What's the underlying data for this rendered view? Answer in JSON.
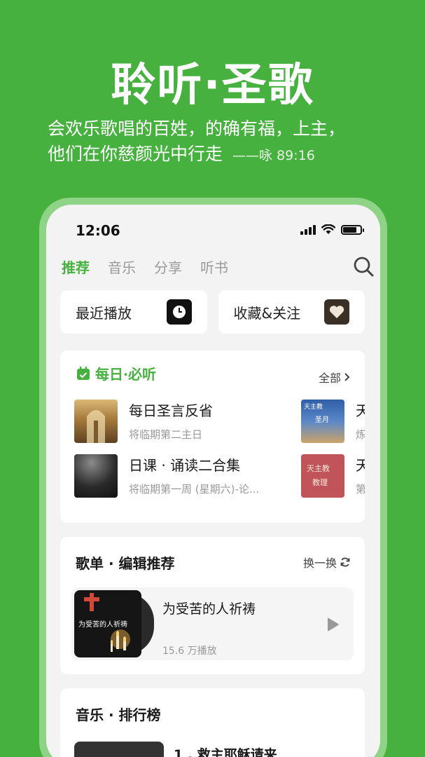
{
  "promo": {
    "title": "聆听·圣歌",
    "verse_line1": "会欢乐歌唱的百姓，的确有福，上主，",
    "verse_line2": "他们在你慈颜光中行走",
    "verse_ref": "——咏 89:16"
  },
  "status_bar": {
    "time": "12:06"
  },
  "tabs": [
    {
      "label": "推荐",
      "active": true
    },
    {
      "label": "音乐",
      "active": false
    },
    {
      "label": "分享",
      "active": false
    },
    {
      "label": "听书",
      "active": false
    }
  ],
  "quick_links": [
    {
      "label": "最近播放",
      "icon": "clock-icon"
    },
    {
      "label": "收藏&关注",
      "icon": "heart-icon"
    }
  ],
  "daily": {
    "title": "每日·必听",
    "see_all": "全部",
    "items": [
      {
        "title": "每日圣言反省",
        "subtitle": "将临期第二主日"
      },
      {
        "title": "日课 · 诵读二合集",
        "subtitle": "将临期第一周 (星期六)-论..."
      },
      {
        "title": "天",
        "subtitle": "炼"
      },
      {
        "title": "天",
        "subtitle": "第"
      }
    ],
    "thumb_texts": [
      "天主教",
      "圣月",
      "天主教",
      "教理"
    ]
  },
  "editor_picks": {
    "title": "歌单 · 编辑推荐",
    "refresh": "换一换",
    "playlist": {
      "cover_text": "为受苦的人祈祷",
      "title": "为受苦的人祈祷",
      "play_count": "15.6 万播放"
    }
  },
  "charts": {
    "title": "音乐 · 排行榜",
    "first_item": "1 . 救主耶稣请来"
  },
  "colors": {
    "brand": "#46b13f",
    "background": "#f3f3f3"
  }
}
